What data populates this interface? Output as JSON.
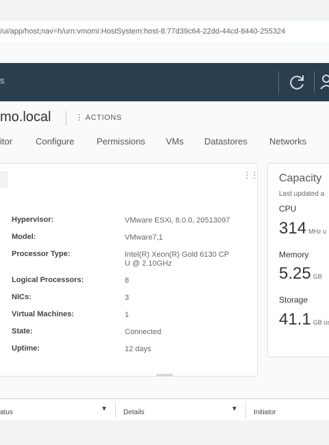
{
  "browser": {
    "url": "/ui/app/host;nav=h/urn:vmomi:HostSystem:host-8:77d39c64-22dd-44cd-8440-255324"
  },
  "header": {
    "left_text": "s",
    "refresh_icon": "refresh-icon",
    "user_icon": "user-icon"
  },
  "host": {
    "title": "mo.local",
    "actions_label": "ACTIONS"
  },
  "tabs": [
    {
      "label": "itor"
    },
    {
      "label": "Configure"
    },
    {
      "label": "Permissions"
    },
    {
      "label": "VMs"
    },
    {
      "label": "Datastores"
    },
    {
      "label": "Networks"
    }
  ],
  "summary": {
    "rows": [
      {
        "label": "Hypervisor:",
        "value": "VMware ESXi, 8.0.0, 20513097"
      },
      {
        "label": "Model:",
        "value": "VMware7,1"
      },
      {
        "label": "Processor Type:",
        "value_line1": "Intel(R) Xeon(R) Gold 6130 CP",
        "value_line2": "U @ 2.10GHz"
      },
      {
        "label": "Logical Processors:",
        "value": "8"
      },
      {
        "label": "NICs:",
        "value": "3"
      },
      {
        "label": "Virtual Machines:",
        "value": "1"
      },
      {
        "label": "State:",
        "value": "Connected"
      },
      {
        "label": "Uptime:",
        "value": "12 days"
      }
    ]
  },
  "capacity": {
    "title": "Capacity",
    "last_updated": "Last updated a",
    "cpu": {
      "label": "CPU",
      "value": "314",
      "unit": "MHz u"
    },
    "memory": {
      "label": "Memory",
      "value": "5.25",
      "unit": "GB"
    },
    "storage": {
      "label": "Storage",
      "value": "41.1",
      "unit": "GB us"
    }
  },
  "tasks_table": {
    "columns": [
      {
        "label": "atus"
      },
      {
        "label": "Details"
      },
      {
        "label": "Initiator"
      }
    ]
  }
}
